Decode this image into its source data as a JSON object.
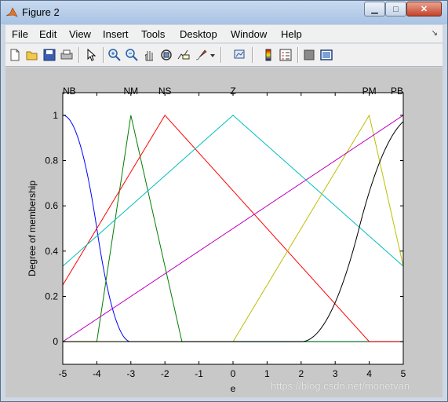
{
  "window": {
    "title": "Figure 2",
    "icon": "matlab-icon",
    "controls": [
      "minimize-button",
      "maximize-button",
      "close-button"
    ]
  },
  "menubar": {
    "items": [
      "File",
      "Edit",
      "View",
      "Insert",
      "Tools",
      "Desktop",
      "Window",
      "Help"
    ],
    "dock_arrow": "↘"
  },
  "toolbar": {
    "icons": [
      "new-figure-icon",
      "open-file-icon",
      "save-icon",
      "print-icon",
      "select-arrow-icon",
      "zoom-in-icon",
      "zoom-out-icon",
      "pan-icon",
      "rotate-3d-icon",
      "data-cursor-icon",
      "brush-icon",
      "brush-dropdown-icon",
      "link-plot-icon",
      "colorbar-icon",
      "legend-icon",
      "hide-plot-tools-icon",
      "show-plot-tools-icon"
    ]
  },
  "watermark": "https://blog.csdn.net/monetvan",
  "chart_data": {
    "type": "line",
    "title": "",
    "xlabel": "e",
    "ylabel": "Degree of membership",
    "xlim": [
      -5,
      5
    ],
    "ylim": [
      -0.1,
      1.1
    ],
    "xticks": [
      "-5",
      "-4",
      "-3",
      "-2",
      "-1",
      "0",
      "1",
      "2",
      "3",
      "4",
      "5"
    ],
    "yticks": [
      "0",
      "0.2",
      "0.4",
      "0.6",
      "0.8",
      "1"
    ],
    "grid": false,
    "series": [
      {
        "name": "NB",
        "color": "#0000ff",
        "shape": "zmf",
        "params": [
          -5,
          -3
        ],
        "label_x": -5,
        "label_anchor": "start"
      },
      {
        "name": "NM",
        "color": "#007f00",
        "shape": "trimf",
        "params": [
          -4,
          -3,
          -1.5
        ],
        "label_x": -3,
        "label_anchor": "middle"
      },
      {
        "name": "NS",
        "color": "#ff0000",
        "shape": "trimf",
        "params": [
          -6,
          -2,
          4
        ],
        "label_x": -2,
        "label_anchor": "middle"
      },
      {
        "name": "Z",
        "color": "#00bfbf",
        "shape": "trimf",
        "params": [
          -7.5,
          0,
          7.5
        ],
        "label_x": 0,
        "label_anchor": "middle"
      },
      {
        "name": "PM",
        "color": "#bfbf00",
        "shape": "trimf",
        "params": [
          0,
          4,
          5.5
        ],
        "label_x": 4,
        "label_anchor": "middle"
      },
      {
        "name": "PB",
        "color": "#000000",
        "shape": "smf",
        "params": [
          2,
          5.4
        ],
        "label_x": 5,
        "label_anchor": "end"
      },
      {
        "name": "",
        "color": "#bf00bf",
        "shape": "line",
        "params": [
          -5,
          0,
          5,
          1
        ],
        "label_x": null,
        "label_anchor": "middle"
      }
    ]
  }
}
